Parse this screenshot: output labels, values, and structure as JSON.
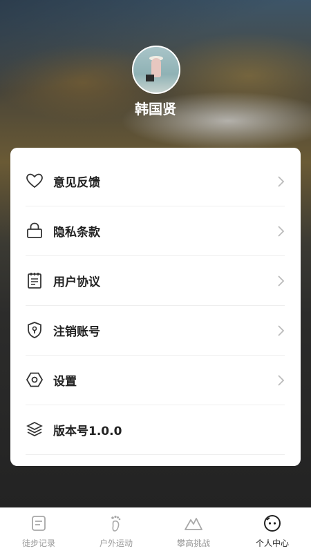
{
  "profile": {
    "name": "韩国贤"
  },
  "menu": [
    {
      "label": "意见反馈",
      "icon": "heart-icon",
      "chevron": true
    },
    {
      "label": "隐私条款",
      "icon": "lock-icon",
      "chevron": true
    },
    {
      "label": "用户协议",
      "icon": "notepad-icon",
      "chevron": true
    },
    {
      "label": "注销账号",
      "icon": "shield-keyhole-icon",
      "chevron": true
    },
    {
      "label": "设置",
      "icon": "hexagon-settings-icon",
      "chevron": true
    },
    {
      "label": "版本号1.0.0",
      "icon": "layers-icon",
      "chevron": false
    }
  ],
  "tabs": [
    {
      "label": "徒步记录",
      "icon": "note-icon",
      "active": false
    },
    {
      "label": "户外运动",
      "icon": "footprint-icon",
      "active": false
    },
    {
      "label": "攀高挑战",
      "icon": "mountain-icon",
      "active": false
    },
    {
      "label": "个人中心",
      "icon": "face-icon",
      "active": true
    }
  ],
  "colors": {
    "active_tab": "#222222",
    "inactive_tab": "#9a9a9a",
    "card": "#ffffff"
  }
}
